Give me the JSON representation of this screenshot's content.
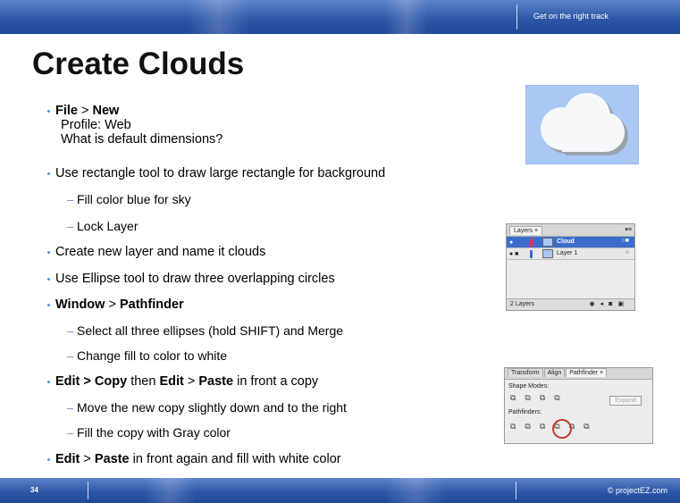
{
  "header": {
    "tagline": "Get on the right track"
  },
  "title": "Create Clouds",
  "bullets": {
    "b1_file": "File",
    "b1_sep": " > ",
    "b1_new": "New",
    "b1_line2": "Profile:  Web",
    "b1_line3": "What is default dimensions?",
    "b2": "Use rectangle tool to draw large rectangle for background",
    "b2_s1": "Fill color blue for sky",
    "b2_s2": "Lock Layer",
    "b3": "Create new layer and name it clouds",
    "b4": "Use Ellipse tool to draw three overlapping circles",
    "b5_window": "Window",
    "b5_sep": " > ",
    "b5_pathfinder": "Pathfinder",
    "b5_s1": "Select all three ellipses (hold SHIFT) and Merge",
    "b5_s2": "Change fill to color to white",
    "b6_edit_copy": "Edit > Copy",
    "b6_then": " then ",
    "b6_edit": "Edit",
    "b6_sep": " > ",
    "b6_paste": "Paste",
    "b6_rest": " in front a copy",
    "b6_s1": "Move the new copy slightly down and to the right",
    "b6_s2": "Fill the copy with Gray color",
    "b7_edit": "Edit",
    "b7_sep": " > ",
    "b7_paste": "Paste",
    "b7_rest": " in front  again and fill with white color"
  },
  "layers_panel": {
    "tab": "Layers ×",
    "layer1": "Cloud",
    "layer2": "Layer 1",
    "count": "2 Layers"
  },
  "pathfinder_panel": {
    "tab_transform": "Transform",
    "tab_align": "Align",
    "tab_pathfinder": "Pathfinder ×",
    "shape_modes": "Shape Modes:",
    "expand": "Expand",
    "pathfinders": "Pathfinders:"
  },
  "footer": {
    "page_number": "34",
    "copyright": "© projectEZ.com"
  },
  "colors": {
    "bar_blue": "#2d57a8",
    "bullet_blue": "#5a8fd6",
    "sky": "#a9c8f4",
    "highlight_ring": "#c0392b"
  }
}
